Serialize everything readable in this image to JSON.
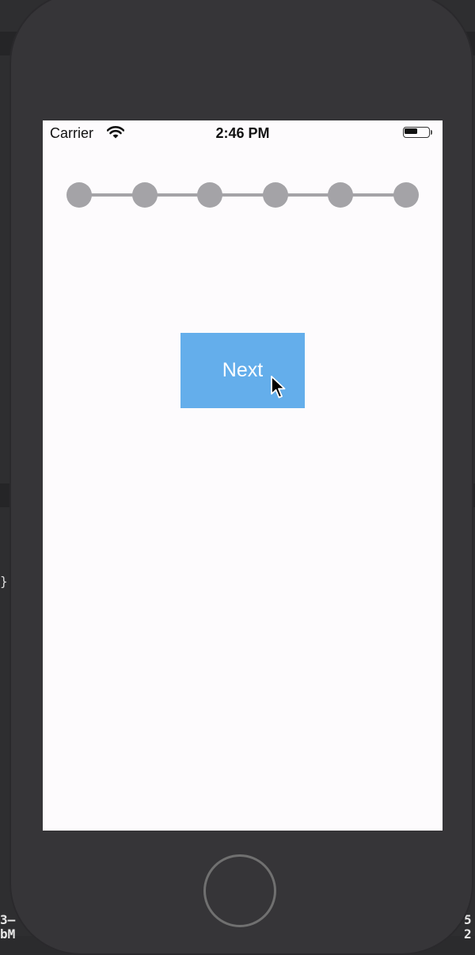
{
  "background": {
    "code_brace": "}",
    "bottom_left_text": "3–\nbM",
    "bottom_right_text": "5\n2"
  },
  "status_bar": {
    "carrier": "Carrier",
    "time": "2:46 PM",
    "wifi_icon": "wifi-icon",
    "battery_icon": "battery-icon",
    "battery_level": 0.55
  },
  "stepper": {
    "steps": 6,
    "active_step": null,
    "dot_color": "#a4a3a7"
  },
  "next_button": {
    "label": "Next",
    "color": "#64aeeb"
  },
  "colors": {
    "device": "#363538",
    "screen": "#fdfbfd"
  }
}
